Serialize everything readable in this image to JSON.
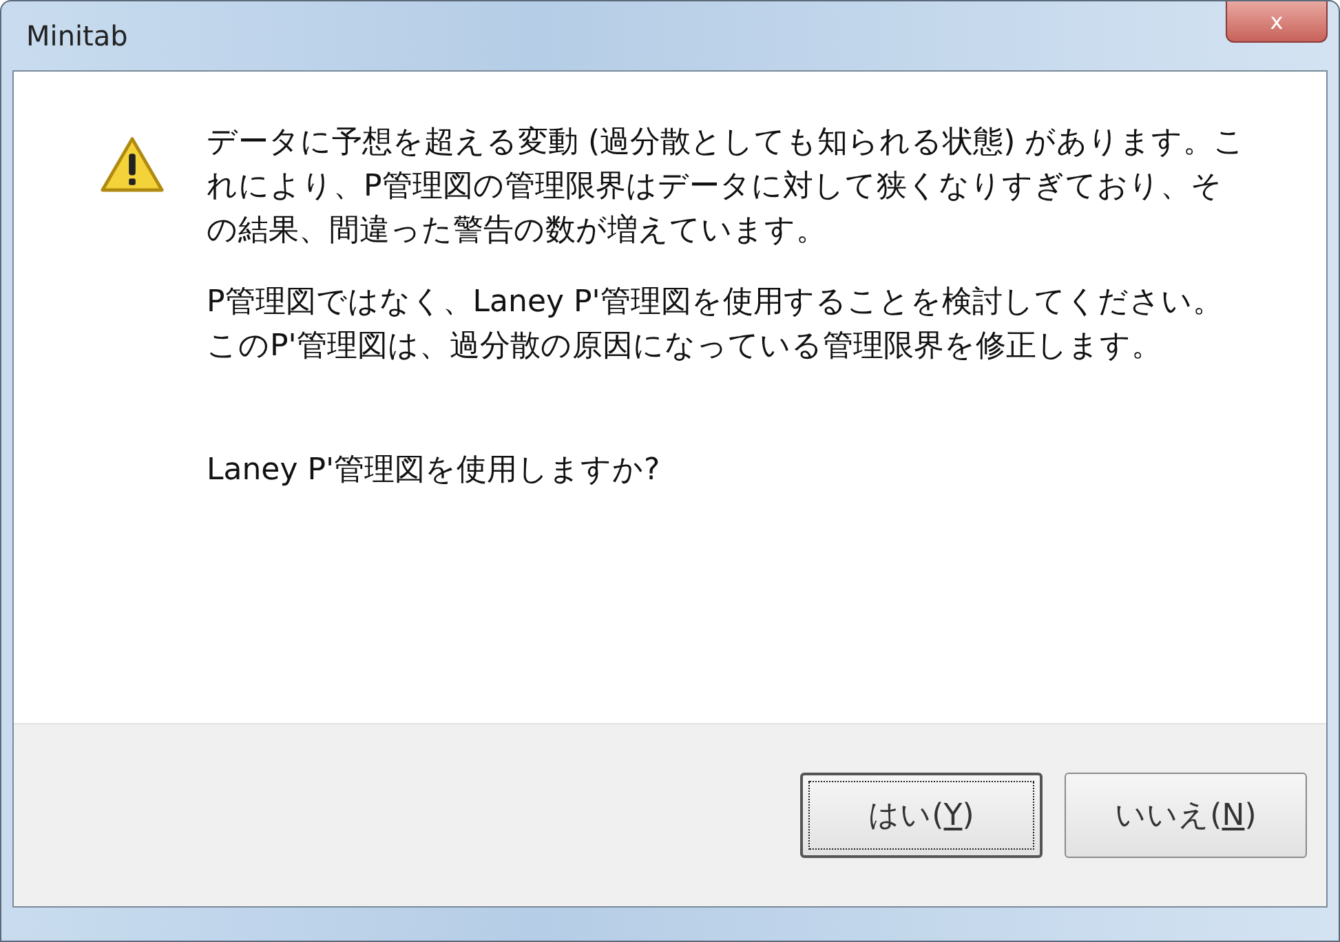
{
  "window": {
    "title": "Minitab",
    "close_label": "x"
  },
  "message": {
    "kind": "warning",
    "paragraphs": [
      "データに予想を超える変動 (過分散としても知られる状態) があります。これにより、P管理図の管理限界はデータに対して狭くなりすぎており、その結果、間違った警告の数が増えています。",
      "P管理図ではなく、Laney P'管理図を使用することを検討してください。このP'管理図は、過分散の原因になっている管理限界を修正します。"
    ],
    "question": "Laney P'管理図を使用しますか?"
  },
  "buttons": [
    {
      "before": "はい(",
      "key": "Y",
      "after": ")",
      "default": true
    },
    {
      "before": "いいえ(",
      "key": "N",
      "after": ")",
      "default": false
    }
  ]
}
